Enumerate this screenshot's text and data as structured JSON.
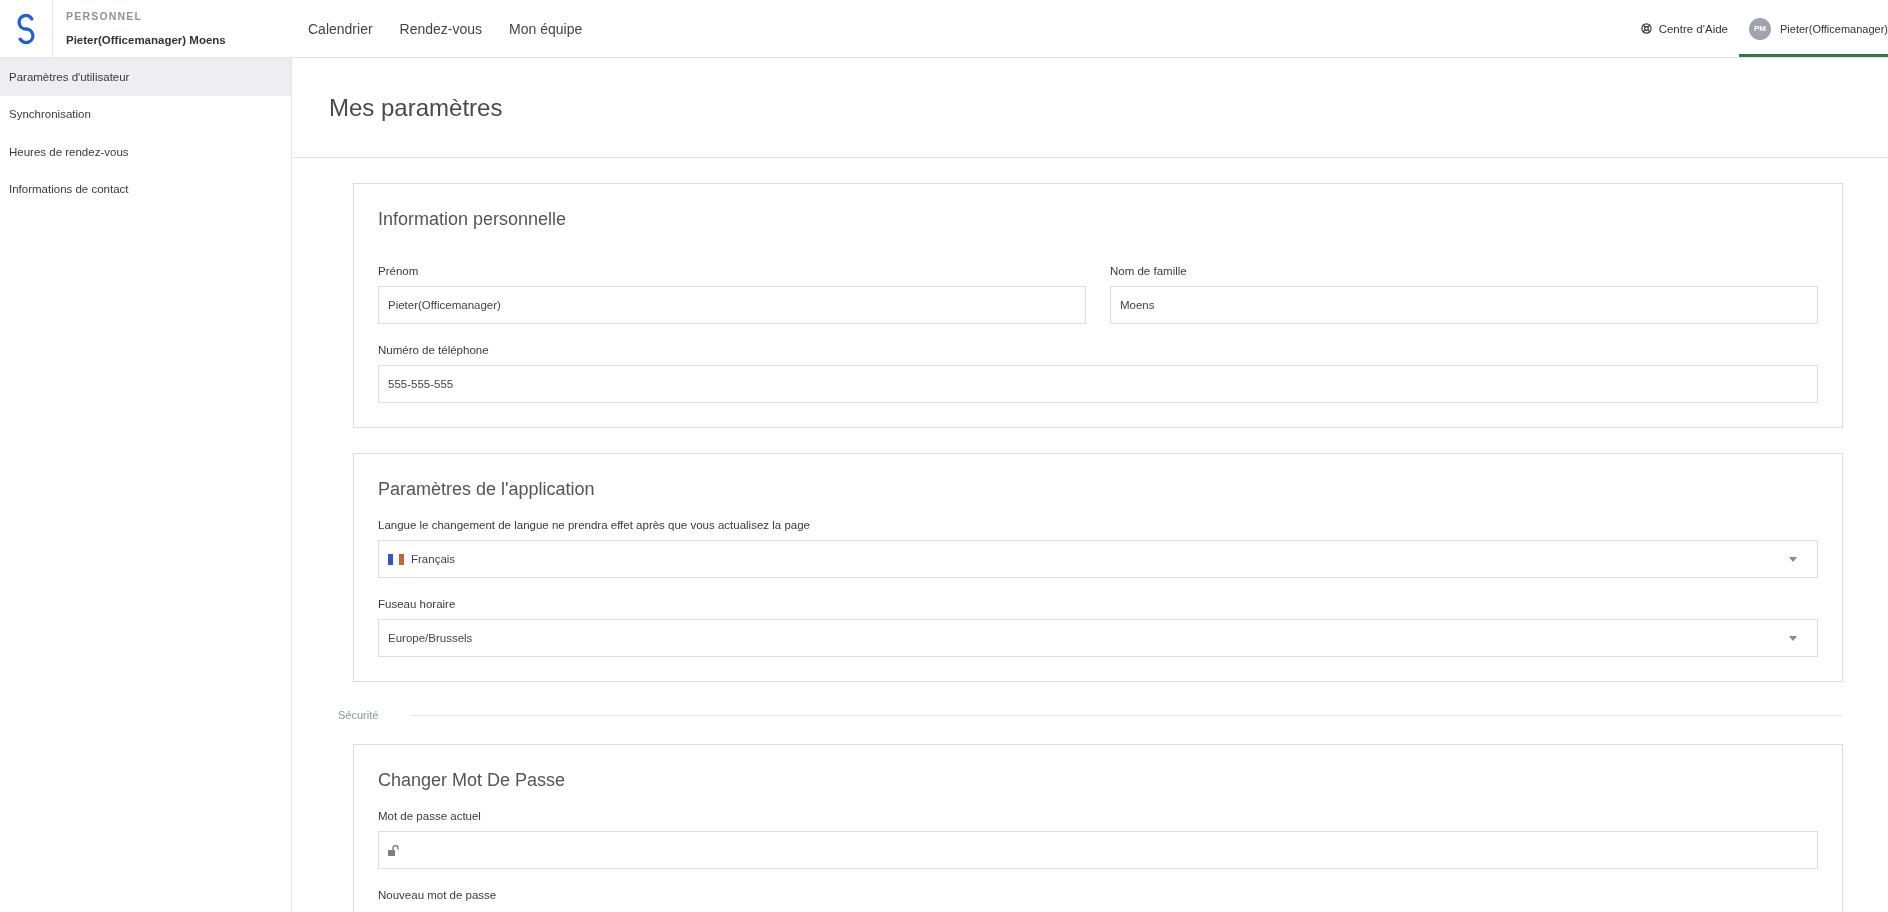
{
  "header": {
    "section": "PERSONNEL",
    "user_name": "Pieter(Officemanager) Moens",
    "nav": [
      {
        "label": "Calendrier",
        "selected": false
      },
      {
        "label": "Rendez-vous",
        "selected": false
      },
      {
        "label": "Mon équipe",
        "selected": false
      }
    ],
    "help": {
      "label": "Centre d'Aide"
    },
    "user_menu": {
      "initials": "PM",
      "name": "Pieter(Officemanager)",
      "selected": true
    }
  },
  "sidebar": {
    "items": [
      {
        "label": "Paramètres d'utilisateur",
        "selected": true
      },
      {
        "label": "Synchronisation",
        "selected": false
      },
      {
        "label": "Heures de rendez-vous",
        "selected": false
      },
      {
        "label": "Informations de contact",
        "selected": false
      }
    ]
  },
  "page": {
    "title": "Mes paramètres",
    "blocks": [
      {
        "kind": "card",
        "title": "Information personnelle",
        "rows": [
          [
            {
              "kind": "text",
              "label": "Prénom",
              "value": "Pieter(Officemanager)"
            },
            {
              "kind": "text",
              "label": "Nom de famille",
              "value": "Moens"
            }
          ],
          [
            {
              "kind": "text",
              "label": "Numéro de téléphone",
              "value": "555-555-555"
            }
          ]
        ]
      },
      {
        "kind": "card",
        "title": "Paramètres de l'application",
        "rows": [
          [
            {
              "kind": "flag-select",
              "label": "Langue le changement de langue ne prendra effet après que vous actualisez la page",
              "value": "Français"
            }
          ],
          [
            {
              "kind": "select",
              "label": "Fuseau horaire",
              "value": "Europe/Brussels"
            }
          ]
        ]
      },
      {
        "kind": "divider",
        "label": "Sécurité"
      },
      {
        "kind": "card",
        "title": "Changer Mot De Passe",
        "rows": [
          [
            {
              "kind": "password",
              "label": "Mot de passe actuel"
            }
          ],
          [
            {
              "kind": "label",
              "label": "Nouveau mot de passe"
            }
          ]
        ]
      }
    ]
  }
}
